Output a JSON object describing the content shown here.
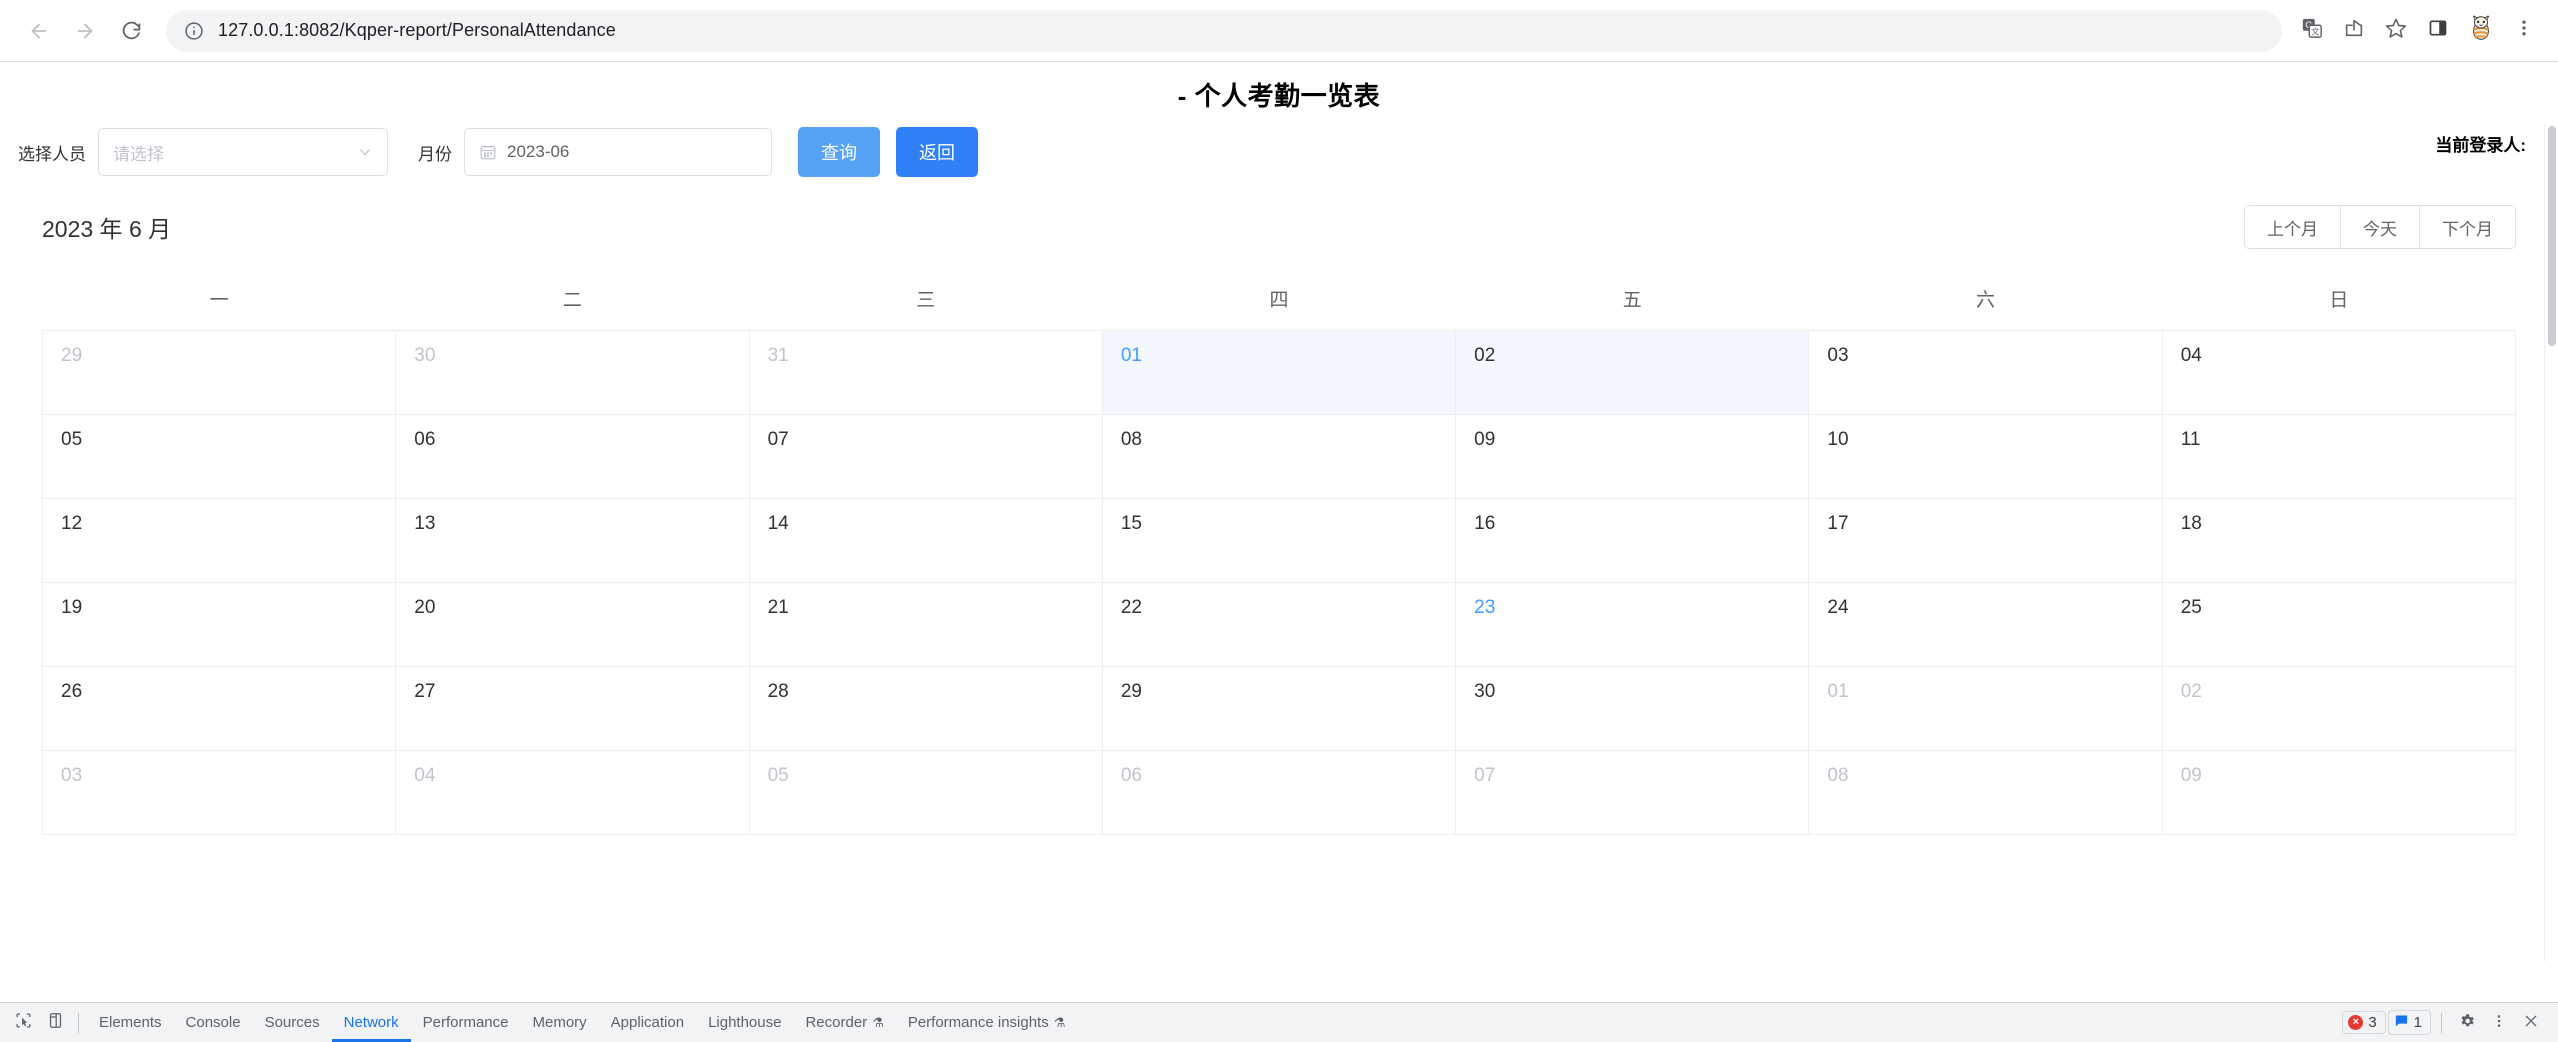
{
  "browser": {
    "url": "127.0.0.1:8082/Kqper-report/PersonalAttendance",
    "back_icon": "back-arrow-icon",
    "forward_icon": "forward-arrow-icon",
    "reload_icon": "reload-icon",
    "site_info_icon": "info-circle-icon",
    "translate_icon": "translate-icon",
    "share_icon": "share-icon",
    "bookmark_icon": "star-icon",
    "side_panel_icon": "side-panel-icon",
    "avatar_icon": "profile-avatar-icon",
    "menu_icon": "kebab-menu-icon"
  },
  "page": {
    "title": "- 个人考勤一览表",
    "login_user_label": "当前登录人:"
  },
  "toolbar": {
    "person_label": "选择人员",
    "person_placeholder": "请选择",
    "month_label": "月份",
    "month_value": "2023-06",
    "query_label": "查询",
    "back_label": "返回",
    "query_color": "#56a2f5",
    "back_color": "#2f80f7"
  },
  "calendar": {
    "title": "2023 年 6 月",
    "nav": {
      "prev_label": "上个月",
      "today_label": "今天",
      "next_label": "下个月"
    },
    "weekdays": [
      "一",
      "二",
      "三",
      "四",
      "五",
      "六",
      "日"
    ],
    "today_color": "#409eff",
    "selected_bg": "#f2f8fe",
    "weeks": [
      [
        {
          "day": "29",
          "type": "prev"
        },
        {
          "day": "30",
          "type": "prev"
        },
        {
          "day": "31",
          "type": "prev"
        },
        {
          "day": "01",
          "type": "current",
          "today": true,
          "selected": true
        },
        {
          "day": "02",
          "type": "current",
          "selected": true
        },
        {
          "day": "03",
          "type": "current"
        },
        {
          "day": "04",
          "type": "current"
        }
      ],
      [
        {
          "day": "05",
          "type": "current"
        },
        {
          "day": "06",
          "type": "current"
        },
        {
          "day": "07",
          "type": "current"
        },
        {
          "day": "08",
          "type": "current"
        },
        {
          "day": "09",
          "type": "current"
        },
        {
          "day": "10",
          "type": "current"
        },
        {
          "day": "11",
          "type": "current"
        }
      ],
      [
        {
          "day": "12",
          "type": "current"
        },
        {
          "day": "13",
          "type": "current"
        },
        {
          "day": "14",
          "type": "current"
        },
        {
          "day": "15",
          "type": "current"
        },
        {
          "day": "16",
          "type": "current"
        },
        {
          "day": "17",
          "type": "current"
        },
        {
          "day": "18",
          "type": "current"
        }
      ],
      [
        {
          "day": "19",
          "type": "current"
        },
        {
          "day": "20",
          "type": "current"
        },
        {
          "day": "21",
          "type": "current"
        },
        {
          "day": "22",
          "type": "current"
        },
        {
          "day": "23",
          "type": "current",
          "today": true
        },
        {
          "day": "24",
          "type": "current"
        },
        {
          "day": "25",
          "type": "current"
        }
      ],
      [
        {
          "day": "26",
          "type": "current"
        },
        {
          "day": "27",
          "type": "current"
        },
        {
          "day": "28",
          "type": "current"
        },
        {
          "day": "29",
          "type": "current"
        },
        {
          "day": "30",
          "type": "current"
        },
        {
          "day": "01",
          "type": "next"
        },
        {
          "day": "02",
          "type": "next"
        }
      ],
      [
        {
          "day": "03",
          "type": "next"
        },
        {
          "day": "04",
          "type": "next"
        },
        {
          "day": "05",
          "type": "next"
        },
        {
          "day": "06",
          "type": "next"
        },
        {
          "day": "07",
          "type": "next"
        },
        {
          "day": "08",
          "type": "next"
        },
        {
          "day": "09",
          "type": "next"
        }
      ]
    ]
  },
  "devtools": {
    "inspect_icon": "inspect-cursor-icon",
    "device_icon": "device-toolbar-icon",
    "tabs": [
      {
        "label": "Elements",
        "active": false
      },
      {
        "label": "Console",
        "active": false
      },
      {
        "label": "Sources",
        "active": false
      },
      {
        "label": "Network",
        "active": true
      },
      {
        "label": "Performance",
        "active": false
      },
      {
        "label": "Memory",
        "active": false
      },
      {
        "label": "Application",
        "active": false
      },
      {
        "label": "Lighthouse",
        "active": false
      },
      {
        "label": "Recorder",
        "active": false,
        "flask": "⚗"
      },
      {
        "label": "Performance insights",
        "active": false,
        "flask": "⚗"
      }
    ],
    "error_count": "3",
    "message_count": "1",
    "settings_icon": "gear-icon",
    "more_icon": "kebab-menu-icon",
    "close_icon": "close-icon"
  }
}
